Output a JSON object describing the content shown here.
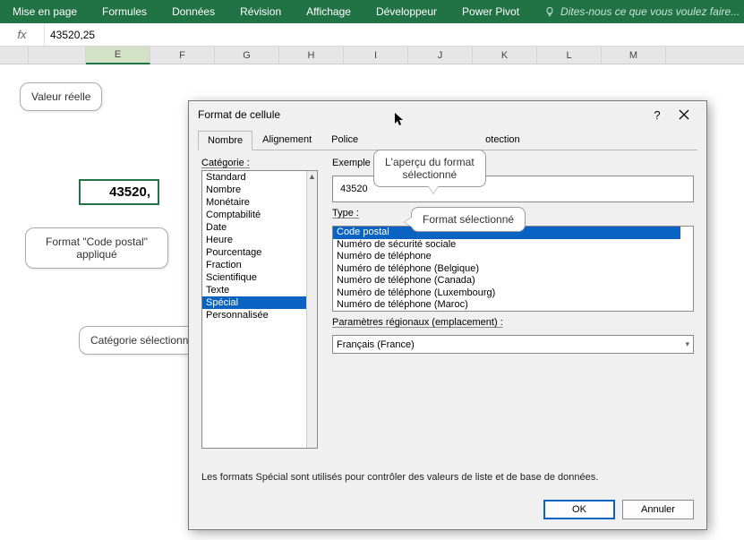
{
  "ribbon": {
    "tabs": [
      "Mise en page",
      "Formules",
      "Données",
      "Révision",
      "Affichage",
      "Développeur",
      "Power Pivot"
    ],
    "tellme": "Dites-nous ce que vous voulez faire..."
  },
  "formula_bar": {
    "fx": "fx",
    "value": "43520,25"
  },
  "columns": [
    "E",
    "F",
    "G",
    "H",
    "I",
    "J",
    "K",
    "L",
    "M"
  ],
  "selected_column": "E",
  "callouts": {
    "real_value": "Valeur réelle",
    "format_applied_1": "Format \"Code postal\"",
    "format_applied_2": "appliqué",
    "category_selected": "Catégorie sélectionnée",
    "preview_1": "L'aperçu du format",
    "preview_2": "sélectionné",
    "format_selected": "Format sélectionné"
  },
  "cell_value": "43520,",
  "dialog": {
    "title": "Format de cellule",
    "help": "?",
    "tabs": [
      "Nombre",
      "Alignement",
      "Police",
      "",
      "",
      "otection"
    ],
    "category_label": "Catégorie :",
    "categories": [
      "Standard",
      "Nombre",
      "Monétaire",
      "Comptabilité",
      "Date",
      "Heure",
      "Pourcentage",
      "Fraction",
      "Scientifique",
      "Texte",
      "Spécial",
      "Personnalisée"
    ],
    "selected_category": "Spécial",
    "sample_label": "Exemple",
    "sample_value": "43520",
    "type_label": "Type :",
    "types": [
      "Code postal",
      "Numéro de sécurité sociale",
      "Numéro de téléphone",
      "Numéro de téléphone (Belgique)",
      "Numéro de téléphone (Canada)",
      "Numéro de téléphone (Luxembourg)",
      "Numéro de téléphone (Maroc)"
    ],
    "selected_type": "Code postal",
    "locale_label": "Paramètres régionaux (emplacement) :",
    "locale_value": "Français (France)",
    "description": "Les formats Spécial sont utilisés pour contrôler des valeurs de liste et de base de données.",
    "ok": "OK",
    "cancel": "Annuler"
  }
}
